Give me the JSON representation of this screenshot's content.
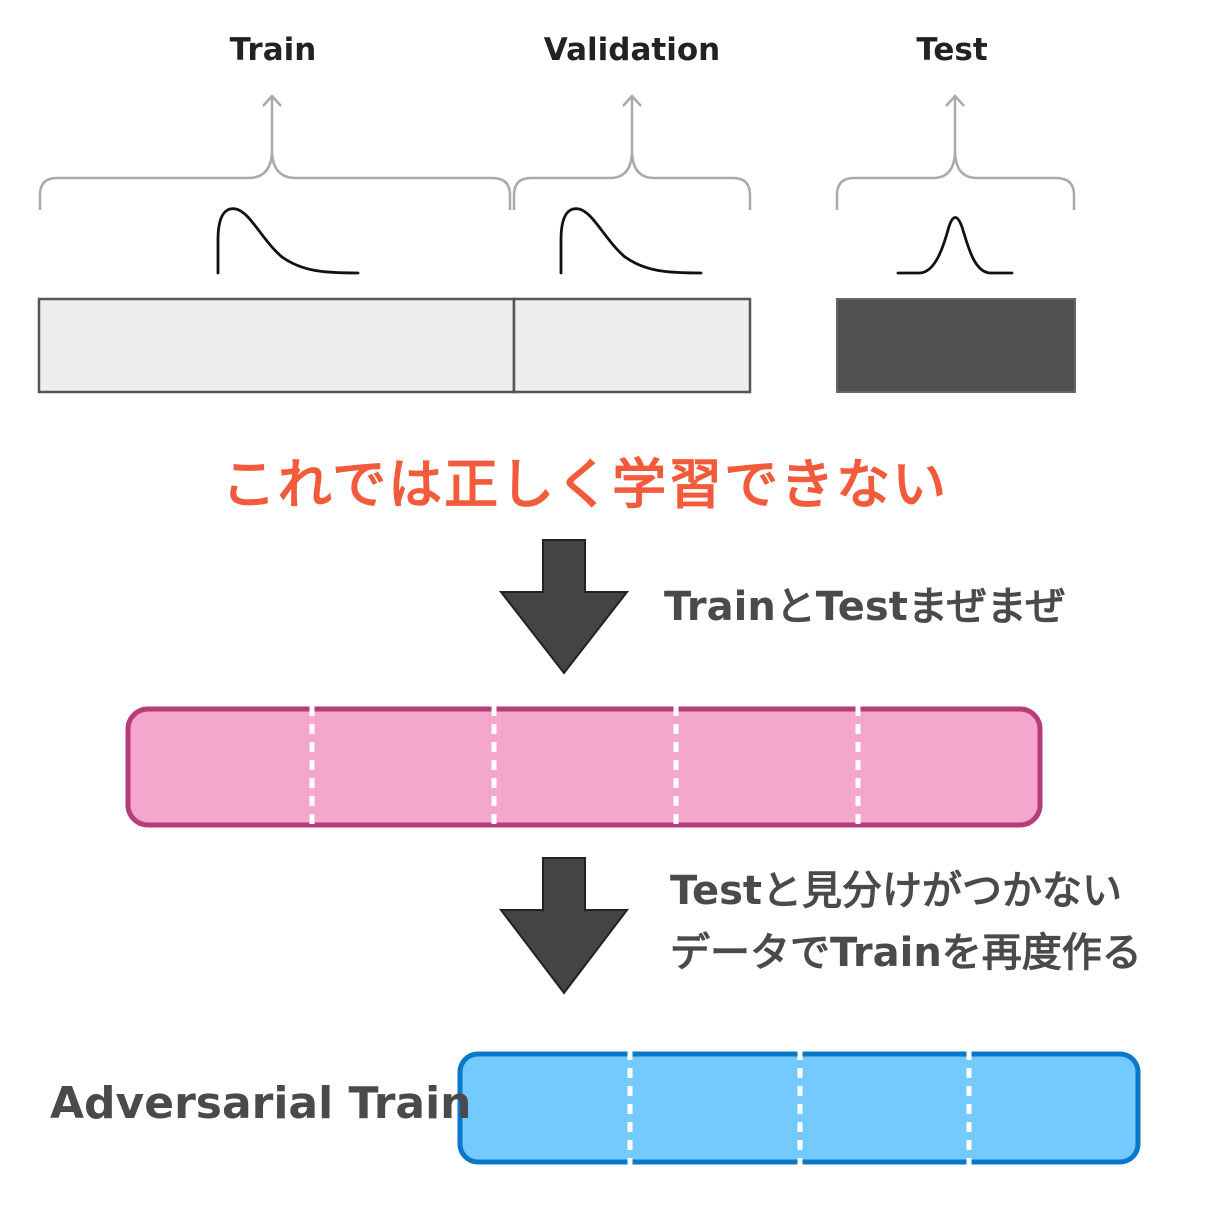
{
  "splits": {
    "train_label": "Train",
    "validation_label": "Validation",
    "test_label": "Test"
  },
  "warning_text": "これでは正しく学習できない",
  "step1_text": "TrainとTestまぜまぜ",
  "step2_lines": [
    "Testと見分けがつかない",
    "データでTrainを再度作る"
  ],
  "adversarial_label": "Adversarial Train",
  "colors": {
    "warning": "#f25a3c",
    "mixed_fill": "#f5a6cd",
    "mixed_border": "#b53d78",
    "adv_fill": "#74c9ff",
    "adv_border": "#0a78c8",
    "test_block": "#505050",
    "train_block": "#eeeeee",
    "arrow": "#444444"
  }
}
